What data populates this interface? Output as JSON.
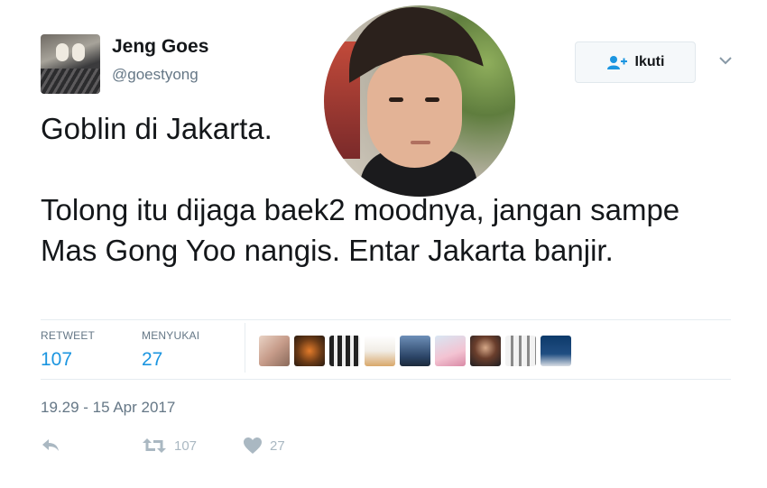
{
  "user": {
    "display_name": "Jeng Goes",
    "handle": "@goestyong"
  },
  "follow_button": {
    "label": "Ikuti",
    "icon": "follow-user-icon"
  },
  "tweet": {
    "line1": "Goblin di Jakarta.",
    "line2": "Tolong itu dijaga baek2 moodnya, jangan sampe Mas Gong Yoo nangis. Entar Jakarta banjir."
  },
  "stats": {
    "retweet_label": "RETWEET",
    "retweet_count": "107",
    "likes_label": "MENYUKAI",
    "likes_count": "27"
  },
  "timestamp": "19.29 - 15 Apr 2017",
  "actions": {
    "reply_icon": "reply-icon",
    "retweet_icon": "retweet-icon",
    "retweet_count": "107",
    "like_icon": "heart-icon",
    "like_count": "27"
  },
  "colors": {
    "accent": "#1b95e0",
    "muted": "#657786",
    "icon_gray": "#aab8c2"
  }
}
